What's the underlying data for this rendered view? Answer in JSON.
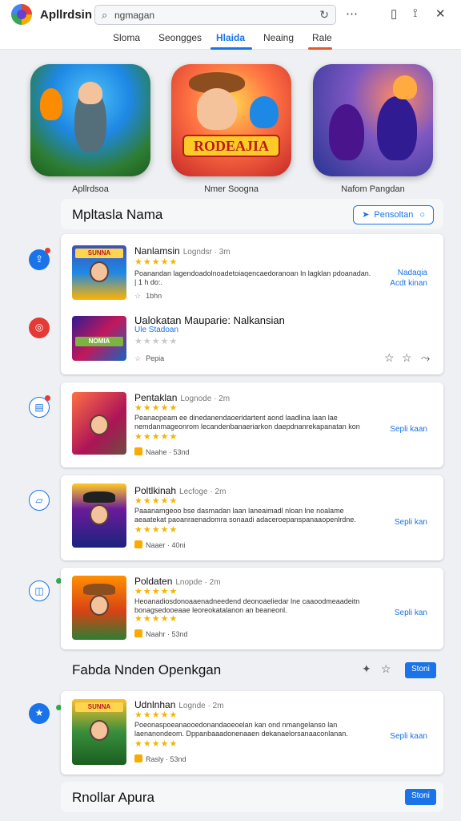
{
  "app": {
    "name": "Apllrdsin"
  },
  "search": {
    "value": "ngmagan",
    "placeholder": "ngmagan"
  },
  "tabs": [
    {
      "label": "Sloma"
    },
    {
      "label": "Seongges"
    },
    {
      "label": "Hlaida"
    },
    {
      "label": "Neaing"
    },
    {
      "label": "Rale"
    }
  ],
  "featured": [
    {
      "label": "Apllrdsoa"
    },
    {
      "label": "Nmer Soogna",
      "banner": "RODEAJIA"
    },
    {
      "label": "Nafom Pangdan"
    }
  ],
  "section1": {
    "title": "Mpltasla Nama",
    "button": "Pensoltan"
  },
  "group1": {
    "items": [
      {
        "title": "Nanlamsin",
        "sub": "Logndsr · 3m",
        "desc": "Poanandan lagendoadolnoadetoiaqencaedoranoan ln lagklan pdoanadan. | 1 h do:.",
        "meta": "1bhn",
        "link": "Nadaqia\nAcdt kinan"
      },
      {
        "title": "Ualokatan Mauparie: Nalkansian",
        "sub": "",
        "tag": "Ule Stadoan",
        "meta": "Pepia"
      }
    ]
  },
  "cards": [
    {
      "title": "Pentaklan",
      "sub": "Lognode · 2m",
      "desc": "Peanaopeam ee dinedanendaoeridartent aond laadlina laan lae nemdanmageonrom lecandenbanaeriarkon daepdnanrekapanatan kon 0eed.",
      "meta": "Naahe · 53nd",
      "link": "Sepli kaan"
    },
    {
      "title": "Poltlkinah",
      "sub": "Lecfoge · 2m",
      "desc": "Paaanamgeoo bse dasmadan laan laneaimadl nloan lne noalame aeaatekat paoanraenadomra sonaadi adaceroepanspanaaopenlrdne.",
      "meta": "Naaer · 40ni",
      "link": "Sepli kan"
    },
    {
      "title": "Poldaten",
      "sub": "Lnopde · 2m",
      "desc": "Heoanadiosdonoaaenadneedend deonoaeliedar lne caaoodmeaadeitn bonagsedooeaae leoreokatalanon an beaneonl.",
      "meta": "Naahr · 53nd",
      "link": "Sepli kan"
    }
  ],
  "section2": {
    "title": "Fabda Nnden Openkgan",
    "button": "Stoni"
  },
  "card_last": {
    "title": "Udnlnhan",
    "sub": "Lognde · 2m",
    "desc": "Poeonaspoeanaooedonandaoeoelan kan ond nmangelanso lan laenanondeom. Dppanbaaadonenaaen dekanaelorsanaaconlanan.",
    "meta": "Rasly · 53nd",
    "link": "Sepli kaan"
  },
  "section3": {
    "title": "Rnollar Apura",
    "button": "Stoni"
  },
  "colors": {
    "accent": "#1a73e8",
    "star": "#f4b400",
    "danger": "#e53935"
  },
  "icons": [
    "app-logo",
    "search-icon",
    "refresh-icon",
    "more-icon",
    "tablet-icon",
    "pin-icon",
    "close-icon",
    "star-icon",
    "share-icon"
  ]
}
